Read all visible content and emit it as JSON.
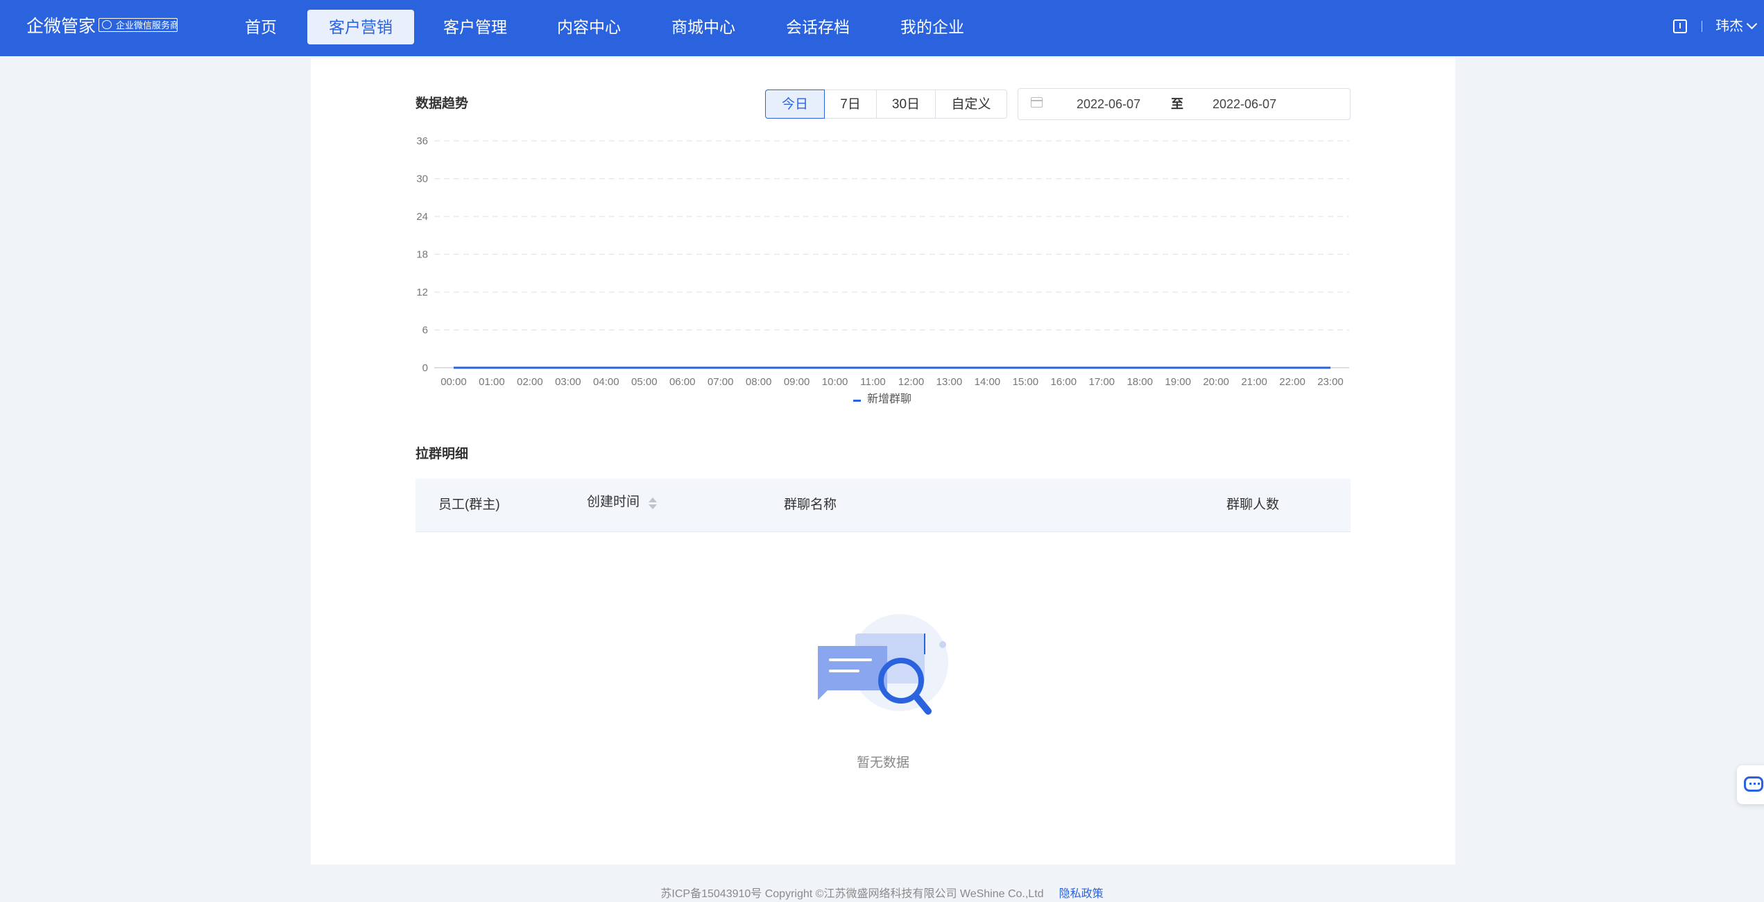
{
  "app": {
    "brand": "企微管家",
    "badge": "企业微信服务商"
  },
  "nav": {
    "items": [
      {
        "label": "首页"
      },
      {
        "label": "客户营销"
      },
      {
        "label": "客户管理"
      },
      {
        "label": "内容中心"
      },
      {
        "label": "商城中心"
      },
      {
        "label": "会话存档"
      },
      {
        "label": "我的企业"
      }
    ],
    "active_index": 1,
    "user": "玮杰"
  },
  "trend": {
    "title": "数据趋势",
    "ranges": [
      "今日",
      "7日",
      "30日",
      "自定义"
    ],
    "active_range": "今日",
    "date_start": "2022-06-07",
    "date_sep": "至",
    "date_end": "2022-06-07"
  },
  "chart_data": {
    "type": "line",
    "x": [
      "00:00",
      "01:00",
      "02:00",
      "03:00",
      "04:00",
      "05:00",
      "06:00",
      "07:00",
      "08:00",
      "09:00",
      "10:00",
      "11:00",
      "12:00",
      "13:00",
      "14:00",
      "15:00",
      "16:00",
      "17:00",
      "18:00",
      "19:00",
      "20:00",
      "21:00",
      "22:00",
      "23:00"
    ],
    "series": [
      {
        "name": "新增群聊",
        "values": [
          0,
          0,
          0,
          0,
          0,
          0,
          0,
          0,
          0,
          0,
          0,
          0,
          0,
          0,
          0,
          0,
          0,
          0,
          0,
          0,
          0,
          0,
          0,
          0
        ]
      }
    ],
    "yticks": [
      0,
      6,
      12,
      18,
      24,
      30,
      36
    ],
    "ylim": [
      0,
      36
    ],
    "grid": true,
    "legend": "bottom-center",
    "color": "#2b63de"
  },
  "detail": {
    "title": "拉群明细",
    "columns": [
      "员工(群主)",
      "创建时间",
      "群聊名称",
      "群聊人数"
    ],
    "rows": [],
    "empty_text": "暂无数据"
  },
  "footer": {
    "text": "苏ICP备15043910号 Copyright ©江苏微盛网络科技有限公司 WeShine Co.,Ltd",
    "privacy_link": "隐私政策"
  },
  "colors": {
    "primary": "#2b63de",
    "background": "#f0f3f8"
  }
}
